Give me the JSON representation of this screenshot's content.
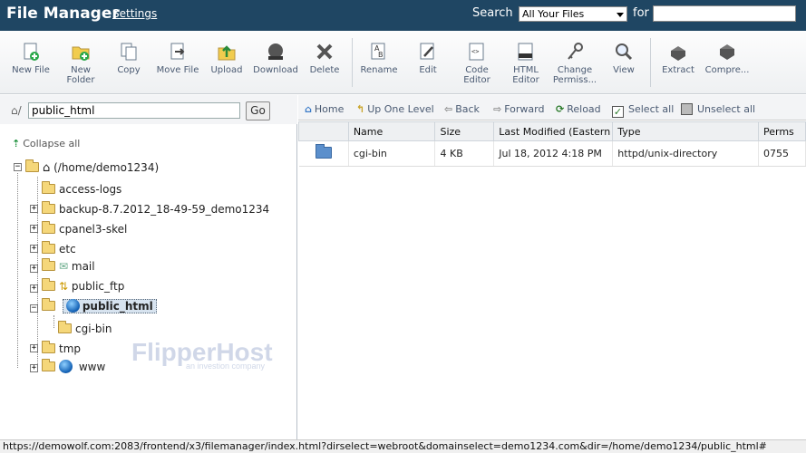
{
  "header": {
    "title": "File Manager",
    "settings_label": "Settings",
    "search_label": "Search",
    "search_scope": "All Your Files",
    "for_label": "for",
    "search_value": ""
  },
  "toolbar": {
    "new_file": "New File",
    "new_folder_line1": "New",
    "new_folder_line2": "Folder",
    "copy": "Copy",
    "move_file": "Move File",
    "upload": "Upload",
    "download": "Download",
    "delete": "Delete",
    "rename": "Rename",
    "edit": "Edit",
    "code_editor_line1": "Code",
    "code_editor_line2": "Editor",
    "html_editor_line1": "HTML",
    "html_editor_line2": "Editor",
    "change_perms_line1": "Change",
    "change_perms_line2": "Permiss...",
    "view": "View",
    "extract": "Extract",
    "compress": "Compre..."
  },
  "path": {
    "value": "public_html",
    "go_label": "Go",
    "collapse_all": "Collapse all"
  },
  "tree": {
    "root": "(/home/demo1234)",
    "items": [
      "access-logs",
      "backup-8.7.2012_18-49-59_demo1234",
      "cpanel3-skel",
      "etc",
      "mail",
      "public_ftp",
      "public_html",
      "cgi-bin",
      "tmp",
      "www"
    ]
  },
  "watermark": {
    "brand": "FlipperHost",
    "tagline": "an investion company"
  },
  "nav": {
    "home": "Home",
    "up_one_level": "Up One Level",
    "back": "Back",
    "forward": "Forward",
    "reload": "Reload",
    "select_all": "Select all",
    "unselect_all": "Unselect all"
  },
  "table": {
    "headers": [
      "Name",
      "Size",
      "Last Modified (Eastern Da",
      "Type",
      "Perms"
    ],
    "rows": [
      {
        "name": "cgi-bin",
        "size": "4 KB",
        "modified": "Jul 18, 2012 4:18 PM",
        "type": "httpd/unix-directory",
        "perms": "0755"
      }
    ]
  },
  "status": {
    "url": "https://demowolf.com:2083/frontend/x3/filemanager/index.html?dirselect=webroot&domainselect=demo1234.com&dir=/home/demo1234/public_html#"
  }
}
